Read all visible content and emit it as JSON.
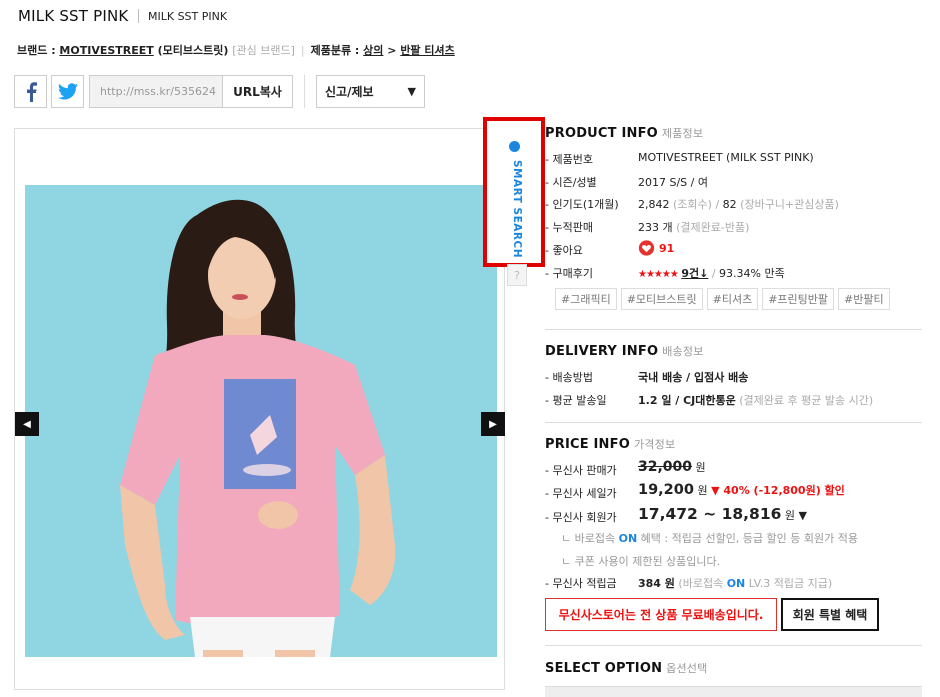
{
  "header": {
    "title": "MILK SST PINK",
    "subtitle": "MILK SST PINK"
  },
  "breadcrumb": {
    "brand_label": "브랜드 : ",
    "brand_name": "MOTIVESTREET",
    "brand_kor": " (모티브스트릿) ",
    "interest_brand": "[관심 브랜드]",
    "category_label": "제품분류 : ",
    "category_main": "상의",
    "category_sep": " > ",
    "category_sub": "반팔 티셔츠"
  },
  "share": {
    "url_value": "http://mss.kr/535624",
    "copy_label": "URL복사",
    "report_label": "신고/제보",
    "report_arrow": "▼"
  },
  "smart_search": {
    "label": "SMART SEARCH",
    "help": "?"
  },
  "product_info": {
    "title": "PRODUCT INFO",
    "title_sub": "제품정보",
    "rows": [
      {
        "label": "- 제품번호",
        "value": "MOTIVESTREET (MILK SST PINK)"
      },
      {
        "label": "- 시즌/성별",
        "value": "2017 S/S / 여"
      },
      {
        "label": "- 인기도(1개월)",
        "value_main": "2,842",
        "value_note": "(조회수)",
        "value_sep": " / ",
        "value_main2": "82",
        "value_note2": "(장바구니+관심상품)"
      },
      {
        "label": "- 누적판매",
        "value_main": "233 개",
        "value_note": "(결제완료-반품)"
      },
      {
        "label": "- 좋아요",
        "value_main": "91"
      },
      {
        "label": "- 구매후기",
        "stars": "★★★★★",
        "review_count": "9건↓",
        "sep": " / ",
        "satisfaction": "93.34% 만족"
      }
    ],
    "tags": [
      "#그래픽티",
      "#모티브스트릿",
      "#티셔츠",
      "#프린팅반팔",
      "#반팔티"
    ]
  },
  "delivery_info": {
    "title": "DELIVERY INFO",
    "title_sub": "배송정보",
    "method_label": "- 배송방법",
    "method_value": "국내 배송 / 입점사 배송",
    "avg_label": "- 평균 발송일",
    "avg_value": "1.2 일 / CJ대한통운",
    "avg_note": "(결제완료 후 평균 발송 시간)"
  },
  "price_info": {
    "title": "PRICE INFO",
    "title_sub": "가격정보",
    "sale_label": "- 무신사 판매가",
    "sale_price": "32,000",
    "won": "원",
    "discount_label": "- 무신사 세일가",
    "discount_price": "19,200",
    "discount_note": "▼ 40% (-12,800원) 할인",
    "member_label": "- 무신사 회원가",
    "member_price": "17,472 ~ 18,816",
    "member_arrow": "▼",
    "note1_pre": "ㄴ 바로접속 ",
    "note1_on": "ON",
    "note1_post": " 혜택 : 적립금 선할인, 등급 할인 등 회원가 적용",
    "note2": "ㄴ 쿠폰 사용이 제한된 상품입니다.",
    "point_label": "- 무신사 적립금",
    "point_value": "384 원",
    "point_note_pre": "(바로접속 ",
    "point_note_on": "ON",
    "point_note_post": " LV.3 적립금 지급)"
  },
  "buttons": {
    "free_shipping": "무신사스토어는 전 상품 무료배송입니다.",
    "member_benefit": "회원 특별 혜택"
  },
  "select_option": {
    "title": "SELECT OPTION",
    "title_sub": "옵션선택"
  },
  "colors": {
    "accent_blue": "#1a86e0",
    "sale_red": "#e11111",
    "photo_bg": "#8fd6e2",
    "shirt_pink": "#f2a9bd"
  }
}
